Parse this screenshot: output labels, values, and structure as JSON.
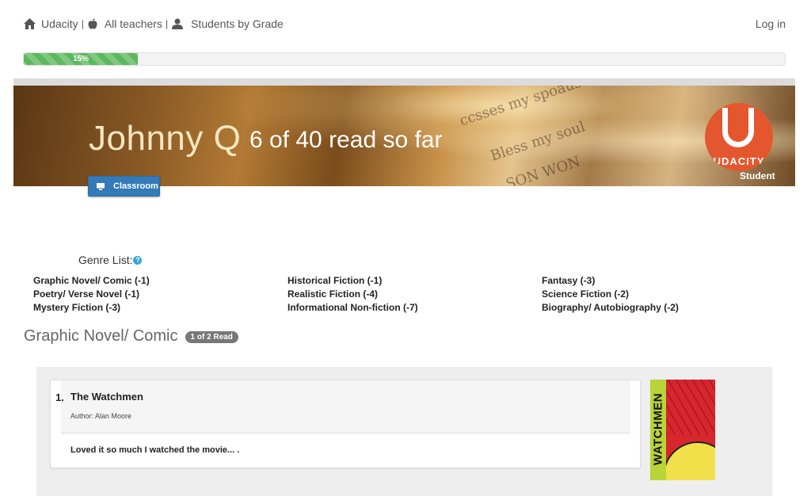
{
  "nav": {
    "home_label": "Udacity",
    "teachers_label": "All teachers",
    "students_label": "Students by Grade",
    "separator": "|",
    "login_label": "Log in"
  },
  "progress": {
    "percent": 15,
    "label": "15%"
  },
  "banner": {
    "student_name": "Johnny Q",
    "read_count": "6 of 40 read so far",
    "logo_text": "UDACITY",
    "role_label": "Student",
    "classroom_button": "Classroom"
  },
  "genres": {
    "title": "Genre List:",
    "help_glyph": "?",
    "items": [
      "Graphic Novel/ Comic (-1)",
      "Poetry/ Verse Novel (-1)",
      "Mystery Fiction (-3)",
      "Historical Fiction (-1)",
      "Realistic Fiction (-4)",
      "Informational Non-fiction (-7)",
      "Fantasy (-3)",
      "Science Fiction (-2)",
      "Biography/ Autobiography (-2)"
    ]
  },
  "section": {
    "title": "Graphic Novel/ Comic",
    "badge": "1 of 2 Read"
  },
  "book": {
    "number": "1.",
    "title": "The Watchmen",
    "author": "Author: Alan Moore",
    "review": "Loved it so much I watched the movie... .",
    "cover_text": "WATCHMEN"
  },
  "colors": {
    "progress_green": "#5cb85c",
    "button_blue": "#337ab7",
    "logo_orange": "#e4572e",
    "help_blue": "#31a9d6",
    "badge_gray": "#777777"
  }
}
